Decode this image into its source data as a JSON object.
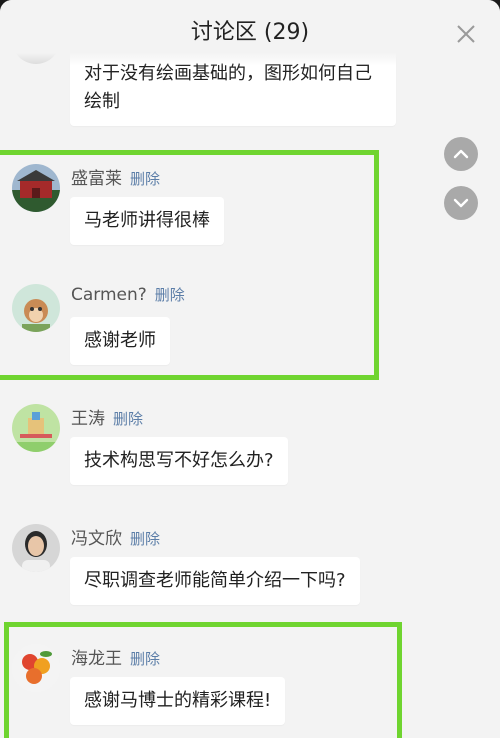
{
  "header": {
    "title": "讨论区 (29)"
  },
  "delete_label": "删除",
  "comments": [
    {
      "name": "",
      "text_lines": [
        "对于没有绘画基础的，图形如何自己",
        "绘制"
      ],
      "avatar": "partial-avatar"
    },
    {
      "name": "盛富莱",
      "text": "马老师讲得很棒",
      "avatar": "building-avatar"
    },
    {
      "name": "Carmen?",
      "text": "感谢老师",
      "avatar": "cartoon-monkey-avatar"
    },
    {
      "name": "王涛",
      "text": "技术构思写不好怎么办?",
      "avatar": "playground-avatar"
    },
    {
      "name": "冯文欣",
      "text": "尽职调查老师能简单介绍一下吗?",
      "avatar": "portrait-avatar"
    },
    {
      "name": "海龙王",
      "text": "感谢马博士的精彩课程!",
      "avatar": "fruit-avatar"
    }
  ],
  "colors": {
    "highlight": "#6fd42f",
    "delete": "#5c7ea8",
    "background": "#f3f3f3"
  },
  "icons": {
    "close": "close-icon",
    "scroll_up": "chevron-up-icon",
    "scroll_down": "chevron-down-icon"
  }
}
